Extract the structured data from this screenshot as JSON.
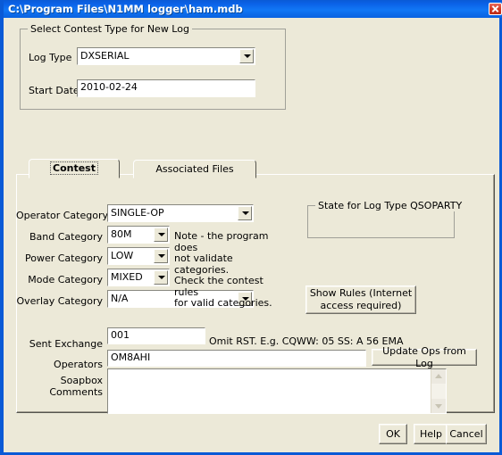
{
  "window": {
    "title": "C:\\Program Files\\N1MM logger\\ham.mdb",
    "close_icon": "close-icon"
  },
  "contest_type_group": {
    "title": "Select Contest Type for New Log",
    "log_type": {
      "label": "Log Type",
      "value": "DXSERIAL",
      "arrow_icon": "chevron-down-icon"
    },
    "start_date": {
      "label": "Start Date",
      "value": "2010-02-24"
    }
  },
  "tabs": [
    {
      "label": "Contest",
      "selected": true
    },
    {
      "label": "Associated Files",
      "selected": false
    }
  ],
  "contest_tab": {
    "operator_category": {
      "label": "Operator Category",
      "value": "SINGLE-OP",
      "arrow_icon": "chevron-down-icon"
    },
    "band_category": {
      "label": "Band Category",
      "value": "80M",
      "arrow_icon": "chevron-down-icon"
    },
    "power_category": {
      "label": "Power Category",
      "value": "LOW",
      "arrow_icon": "chevron-down-icon"
    },
    "mode_category": {
      "label": "Mode Category",
      "value": "MIXED",
      "arrow_icon": "chevron-down-icon"
    },
    "overlay_category": {
      "label": "Overlay Category",
      "value": "N/A",
      "arrow_icon": "chevron-down-icon"
    },
    "note": "Note -  the program does\nnot validate categories.\nCheck the contest rules\nfor valid categories.",
    "state_group_title": "State for Log Type QSOPARTY",
    "state_value": "",
    "show_rules_button": "Show Rules (Internet\naccess required)",
    "sent_exchange": {
      "label": "Sent Exchange",
      "value": "001"
    },
    "exchange_hint": "Omit RST. E.g. CQWW: 05    SS: A 56 EMA",
    "operators": {
      "label": "Operators",
      "value": "OM8AHI"
    },
    "update_ops_button": "Update Ops from Log",
    "soapbox": {
      "label": "Soapbox\nComments",
      "value": "",
      "scroll_up_icon": "chevron-up-icon",
      "scroll_down_icon": "chevron-down-icon"
    }
  },
  "footer": {
    "ok": "OK",
    "help": "Help",
    "cancel": "Cancel"
  },
  "colors": {
    "title_bar": "#0a5ad6",
    "window_face": "#ece9d8",
    "close_button": "#d63c26"
  }
}
